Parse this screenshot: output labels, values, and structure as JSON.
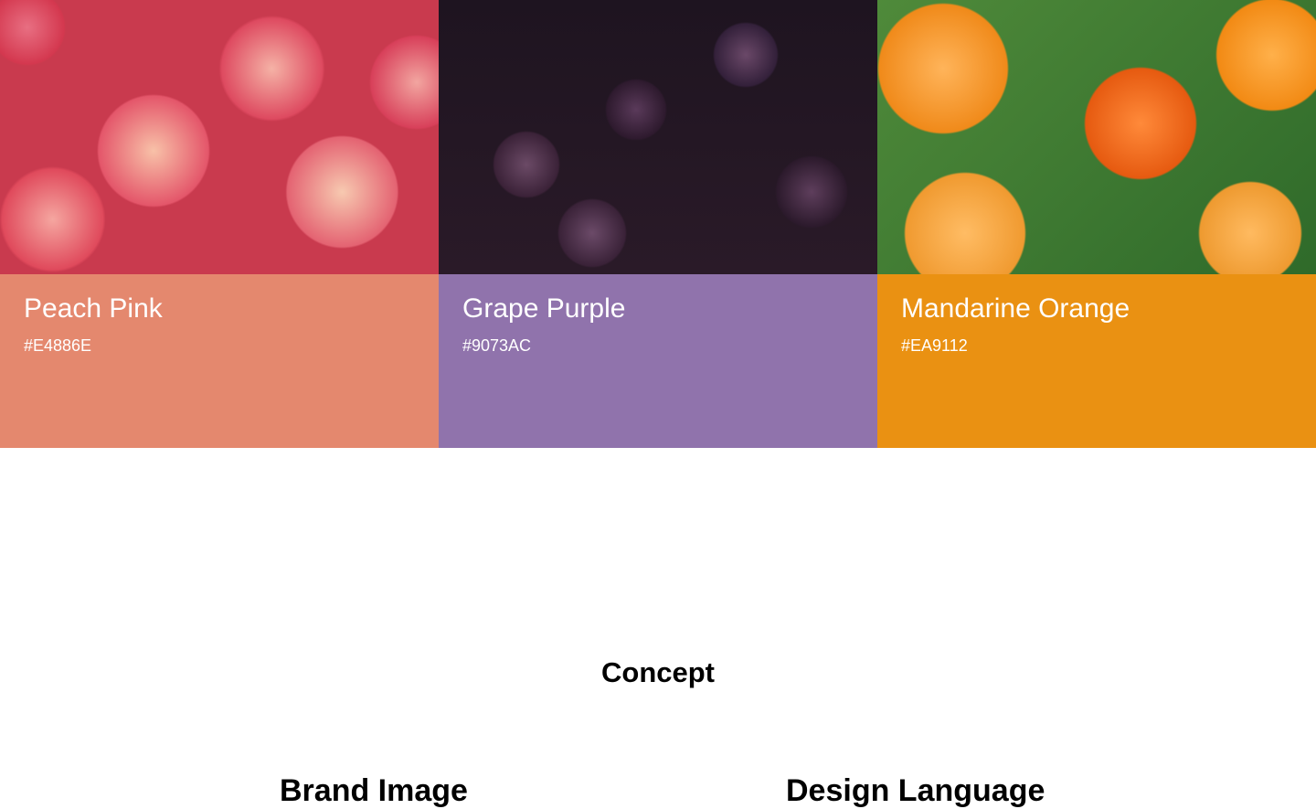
{
  "swatches": [
    {
      "name": "Peach Pink",
      "hex": "#E4886E",
      "color": "#E4886E",
      "photo": "peaches"
    },
    {
      "name": "Grape Purple",
      "hex": "#9073AC",
      "color": "#9073AC",
      "photo": "grapes"
    },
    {
      "name": "Mandarine Orange",
      "hex": "#EA9112",
      "color": "#EA9112",
      "photo": "mandarines"
    }
  ],
  "concept": {
    "title": "Concept",
    "columns": [
      "Brand Image",
      "Design Language"
    ]
  }
}
